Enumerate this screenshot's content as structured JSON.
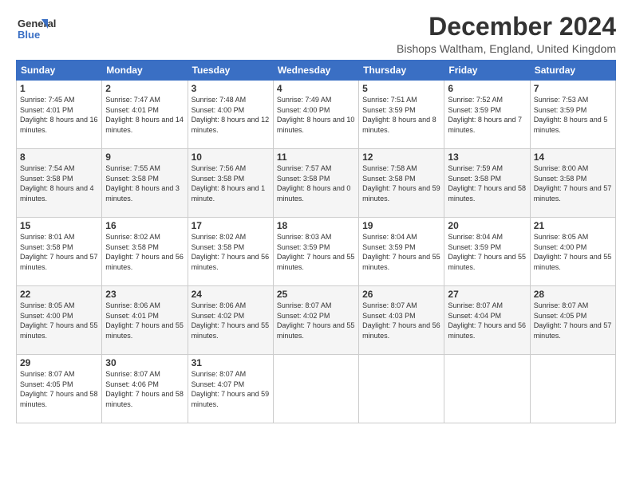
{
  "header": {
    "logo_line1": "General",
    "logo_line2": "Blue",
    "month_title": "December 2024",
    "subtitle": "Bishops Waltham, England, United Kingdom"
  },
  "days_of_week": [
    "Sunday",
    "Monday",
    "Tuesday",
    "Wednesday",
    "Thursday",
    "Friday",
    "Saturday"
  ],
  "weeks": [
    [
      {
        "day": "1",
        "info": "Sunrise: 7:45 AM\nSunset: 4:01 PM\nDaylight: 8 hours\nand 16 minutes."
      },
      {
        "day": "2",
        "info": "Sunrise: 7:47 AM\nSunset: 4:01 PM\nDaylight: 8 hours\nand 14 minutes."
      },
      {
        "day": "3",
        "info": "Sunrise: 7:48 AM\nSunset: 4:00 PM\nDaylight: 8 hours\nand 12 minutes."
      },
      {
        "day": "4",
        "info": "Sunrise: 7:49 AM\nSunset: 4:00 PM\nDaylight: 8 hours\nand 10 minutes."
      },
      {
        "day": "5",
        "info": "Sunrise: 7:51 AM\nSunset: 3:59 PM\nDaylight: 8 hours\nand 8 minutes."
      },
      {
        "day": "6",
        "info": "Sunrise: 7:52 AM\nSunset: 3:59 PM\nDaylight: 8 hours\nand 7 minutes."
      },
      {
        "day": "7",
        "info": "Sunrise: 7:53 AM\nSunset: 3:59 PM\nDaylight: 8 hours\nand 5 minutes."
      }
    ],
    [
      {
        "day": "8",
        "info": "Sunrise: 7:54 AM\nSunset: 3:58 PM\nDaylight: 8 hours\nand 4 minutes."
      },
      {
        "day": "9",
        "info": "Sunrise: 7:55 AM\nSunset: 3:58 PM\nDaylight: 8 hours\nand 3 minutes."
      },
      {
        "day": "10",
        "info": "Sunrise: 7:56 AM\nSunset: 3:58 PM\nDaylight: 8 hours\nand 1 minute."
      },
      {
        "day": "11",
        "info": "Sunrise: 7:57 AM\nSunset: 3:58 PM\nDaylight: 8 hours\nand 0 minutes."
      },
      {
        "day": "12",
        "info": "Sunrise: 7:58 AM\nSunset: 3:58 PM\nDaylight: 7 hours\nand 59 minutes."
      },
      {
        "day": "13",
        "info": "Sunrise: 7:59 AM\nSunset: 3:58 PM\nDaylight: 7 hours\nand 58 minutes."
      },
      {
        "day": "14",
        "info": "Sunrise: 8:00 AM\nSunset: 3:58 PM\nDaylight: 7 hours\nand 57 minutes."
      }
    ],
    [
      {
        "day": "15",
        "info": "Sunrise: 8:01 AM\nSunset: 3:58 PM\nDaylight: 7 hours\nand 57 minutes."
      },
      {
        "day": "16",
        "info": "Sunrise: 8:02 AM\nSunset: 3:58 PM\nDaylight: 7 hours\nand 56 minutes."
      },
      {
        "day": "17",
        "info": "Sunrise: 8:02 AM\nSunset: 3:58 PM\nDaylight: 7 hours\nand 56 minutes."
      },
      {
        "day": "18",
        "info": "Sunrise: 8:03 AM\nSunset: 3:59 PM\nDaylight: 7 hours\nand 55 minutes."
      },
      {
        "day": "19",
        "info": "Sunrise: 8:04 AM\nSunset: 3:59 PM\nDaylight: 7 hours\nand 55 minutes."
      },
      {
        "day": "20",
        "info": "Sunrise: 8:04 AM\nSunset: 3:59 PM\nDaylight: 7 hours\nand 55 minutes."
      },
      {
        "day": "21",
        "info": "Sunrise: 8:05 AM\nSunset: 4:00 PM\nDaylight: 7 hours\nand 55 minutes."
      }
    ],
    [
      {
        "day": "22",
        "info": "Sunrise: 8:05 AM\nSunset: 4:00 PM\nDaylight: 7 hours\nand 55 minutes."
      },
      {
        "day": "23",
        "info": "Sunrise: 8:06 AM\nSunset: 4:01 PM\nDaylight: 7 hours\nand 55 minutes."
      },
      {
        "day": "24",
        "info": "Sunrise: 8:06 AM\nSunset: 4:02 PM\nDaylight: 7 hours\nand 55 minutes."
      },
      {
        "day": "25",
        "info": "Sunrise: 8:07 AM\nSunset: 4:02 PM\nDaylight: 7 hours\nand 55 minutes."
      },
      {
        "day": "26",
        "info": "Sunrise: 8:07 AM\nSunset: 4:03 PM\nDaylight: 7 hours\nand 56 minutes."
      },
      {
        "day": "27",
        "info": "Sunrise: 8:07 AM\nSunset: 4:04 PM\nDaylight: 7 hours\nand 56 minutes."
      },
      {
        "day": "28",
        "info": "Sunrise: 8:07 AM\nSunset: 4:05 PM\nDaylight: 7 hours\nand 57 minutes."
      }
    ],
    [
      {
        "day": "29",
        "info": "Sunrise: 8:07 AM\nSunset: 4:05 PM\nDaylight: 7 hours\nand 58 minutes."
      },
      {
        "day": "30",
        "info": "Sunrise: 8:07 AM\nSunset: 4:06 PM\nDaylight: 7 hours\nand 58 minutes."
      },
      {
        "day": "31",
        "info": "Sunrise: 8:07 AM\nSunset: 4:07 PM\nDaylight: 7 hours\nand 59 minutes."
      },
      {
        "day": "",
        "info": ""
      },
      {
        "day": "",
        "info": ""
      },
      {
        "day": "",
        "info": ""
      },
      {
        "day": "",
        "info": ""
      }
    ]
  ]
}
